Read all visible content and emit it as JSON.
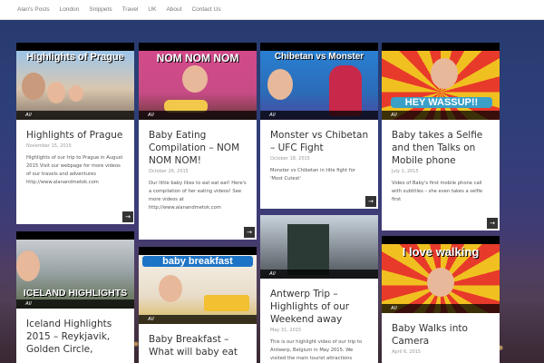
{
  "nav": [
    "Alan's Posts",
    "London",
    "Snippets",
    "Travel",
    "UK",
    "About",
    "Contact Us"
  ],
  "posts": [
    {
      "banner": "Highlights of Prague",
      "category": "All",
      "title": "Highlights of Prague",
      "date": "November 15, 2015",
      "excerpt": "Highlights of our trip to Prague in August 2015 Visit our webpage for more videos of our travels and adventures http://www.alanandmetok.com",
      "arrow": "→"
    },
    {
      "banner": "NOM NOM NOM",
      "category": "All",
      "title": "Baby Eating Compilation – NOM NOM NOM!",
      "date": "October 26, 2015",
      "excerpt": "Our little baby likes to eat eat eat! Here's a compilation of her eating videos! See more videos at http://www.alanandmetok.com",
      "arrow": "→"
    },
    {
      "banner": "Chibetan vs Monster",
      "category": "All",
      "title": "Monster vs Chibetan – UFC Fight",
      "date": "October 18, 2015",
      "excerpt": "Monster vs Chibetan in title fight for 'Most Cutest'",
      "arrow": "→"
    },
    {
      "banner": "HEY WASSUP!!",
      "category": "All",
      "title": "Baby takes a Selfie and then Talks on Mobile phone",
      "date": "July 1, 2015",
      "excerpt": "Video of Baby's first mobile phone call with subtitles – she even takes a selfie first",
      "arrow": "→"
    },
    {
      "banner": "ICELAND HIGHLIGHTS",
      "category": "All",
      "title": "Iceland Highlights 2015 – Reykjavik, Golden Circle,",
      "date": "",
      "excerpt": "",
      "arrow": ""
    },
    {
      "banner": "baby breakfast",
      "category": "All",
      "title": "Baby Breakfast – What will baby eat",
      "date": "",
      "excerpt": "",
      "arrow": ""
    },
    {
      "banner": "",
      "category": "All",
      "title": "Antwerp Trip – Highlights of our Weekend away",
      "date": "May 31, 2015",
      "excerpt": "This is our highlight video of our trip to Antwerp, Belgium in May 2015. We visited the main tourist attractions",
      "arrow": ""
    },
    {
      "banner": "I love walking",
      "category": "All",
      "title": "Baby Walks into Camera",
      "date": "April 6, 2015",
      "excerpt": "",
      "arrow": ""
    }
  ],
  "colors": {
    "nav_bg": "#ffffff",
    "card_bg": "#ffffff",
    "title": "#333333",
    "arrow_bg": "#333333"
  }
}
